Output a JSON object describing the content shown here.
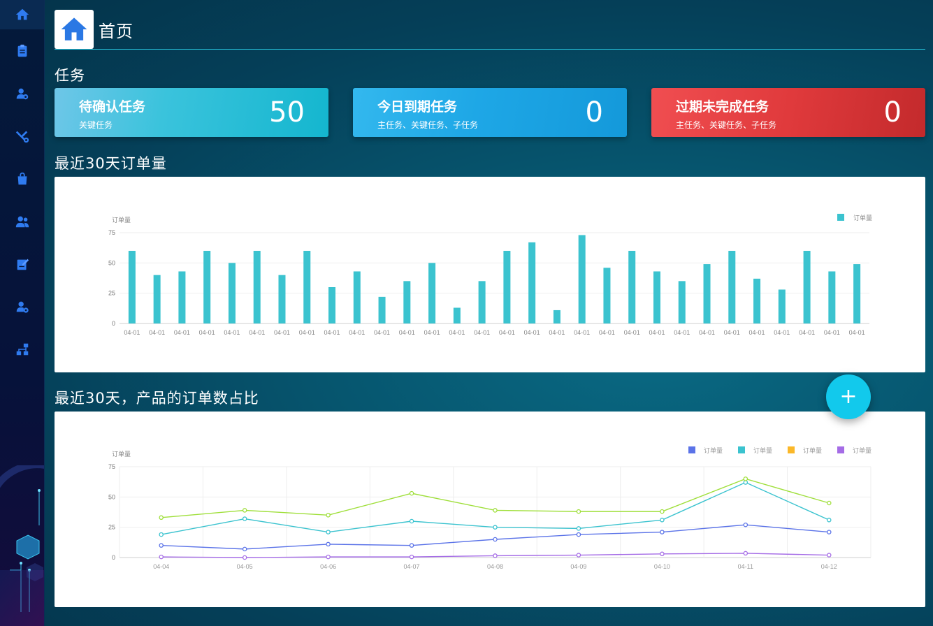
{
  "header": {
    "title": "首页"
  },
  "sidebar": {
    "items": [
      {
        "icon": "home-icon"
      },
      {
        "icon": "clipboard-icon"
      },
      {
        "icon": "user-badge-icon"
      },
      {
        "icon": "tools-icon"
      },
      {
        "icon": "bag-icon"
      },
      {
        "icon": "users-icon"
      },
      {
        "icon": "edit-document-icon"
      },
      {
        "icon": "user-settings-icon"
      },
      {
        "icon": "org-chart-icon"
      }
    ]
  },
  "tasks": {
    "section_title": "任务",
    "cards": [
      {
        "title": "待确认任务",
        "subtitle": "关键任务",
        "value": "50"
      },
      {
        "title": "今日到期任务",
        "subtitle": "主任务、关键任务、子任务",
        "value": "0"
      },
      {
        "title": "过期未完成任务",
        "subtitle": "主任务、关键任务、子任务",
        "value": "0"
      }
    ]
  },
  "bar_section": {
    "title": "最近30天订单量"
  },
  "line_section": {
    "title": "最近30天，产品的订单数占比"
  },
  "fab": {
    "label": "+"
  },
  "colors": {
    "bar": "#3bc3cf",
    "accent": "#12c9ec"
  },
  "chart_data": [
    {
      "type": "bar",
      "ylabel": "订单量",
      "ylim": [
        0,
        75
      ],
      "yticks": [
        "0",
        "25",
        "50",
        "75"
      ],
      "legend": [
        "订单量"
      ],
      "legend_position": "top-right",
      "categories": [
        "04-01",
        "04-01",
        "04-01",
        "04-01",
        "04-01",
        "04-01",
        "04-01",
        "04-01",
        "04-01",
        "04-01",
        "04-01",
        "04-01",
        "04-01",
        "04-01",
        "04-01",
        "04-01",
        "04-01",
        "04-01",
        "04-01",
        "04-01",
        "04-01",
        "04-01",
        "04-01",
        "04-01",
        "04-01",
        "04-01",
        "04-01",
        "04-01",
        "04-01",
        "04-01"
      ],
      "series": [
        {
          "name": "订单量",
          "color": "#3bc3cf",
          "values": [
            60,
            40,
            43,
            60,
            50,
            60,
            40,
            60,
            30,
            43,
            22,
            35,
            50,
            13,
            35,
            60,
            67,
            11,
            73,
            46,
            60,
            43,
            35,
            49,
            60,
            37,
            28,
            60,
            43,
            49
          ]
        }
      ]
    },
    {
      "type": "line",
      "ylabel": "订单量",
      "ylim": [
        0,
        75
      ],
      "yticks": [
        "0",
        "25",
        "50",
        "75"
      ],
      "legend_position": "top-right",
      "categories": [
        "04-04",
        "04-05",
        "04-06",
        "04-07",
        "04-08",
        "04-09",
        "04-10",
        "04-11",
        "04-12"
      ],
      "series": [
        {
          "name": "订单量",
          "color": "#5b73e8",
          "values": [
            10,
            7,
            11,
            10,
            15,
            19,
            21,
            27,
            21
          ]
        },
        {
          "name": "订单量",
          "color": "#3bc3cf",
          "values": [
            19,
            32,
            21,
            30,
            25,
            24,
            31,
            62,
            31
          ]
        },
        {
          "name": "订单量",
          "color": "#fbb829",
          "values": [
            33,
            39,
            35,
            53,
            39,
            38,
            38,
            65,
            45
          ]
        },
        {
          "name": "订单量",
          "color": "#a56ce6",
          "values": [
            0.5,
            0,
            0.5,
            0.5,
            1.5,
            2,
            3,
            3.5,
            2
          ]
        }
      ],
      "line_colors": [
        "#5b73e8",
        "#3bc3cf",
        "#9fdf3a",
        "#a56ce6"
      ]
    }
  ]
}
